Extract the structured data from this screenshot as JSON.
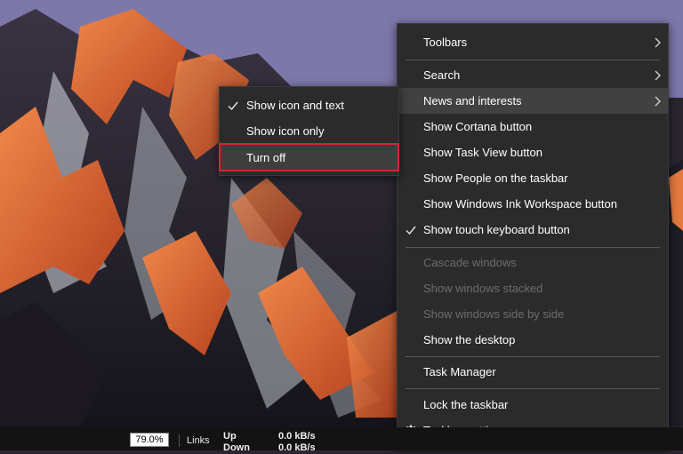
{
  "context_menu": {
    "items": [
      {
        "label": "Toolbars",
        "submenu": true,
        "checked": false,
        "disabled": false
      },
      {
        "label": "Search",
        "submenu": true,
        "checked": false,
        "disabled": false
      },
      {
        "label": "News and interests",
        "submenu": true,
        "checked": false,
        "disabled": false,
        "hovered": true
      },
      {
        "label": "Show Cortana button",
        "submenu": false,
        "checked": false,
        "disabled": false
      },
      {
        "label": "Show Task View button",
        "submenu": false,
        "checked": false,
        "disabled": false
      },
      {
        "label": "Show People on the taskbar",
        "submenu": false,
        "checked": false,
        "disabled": false
      },
      {
        "label": "Show Windows Ink Workspace button",
        "submenu": false,
        "checked": false,
        "disabled": false
      },
      {
        "label": "Show touch keyboard button",
        "submenu": false,
        "checked": true,
        "disabled": false
      },
      {
        "label": "Cascade windows",
        "submenu": false,
        "checked": false,
        "disabled": true
      },
      {
        "label": "Show windows stacked",
        "submenu": false,
        "checked": false,
        "disabled": true
      },
      {
        "label": "Show windows side by side",
        "submenu": false,
        "checked": false,
        "disabled": true
      },
      {
        "label": "Show the desktop",
        "submenu": false,
        "checked": false,
        "disabled": false
      },
      {
        "label": "Task Manager",
        "submenu": false,
        "checked": false,
        "disabled": false
      },
      {
        "label": "Lock the taskbar",
        "submenu": false,
        "checked": false,
        "disabled": false
      },
      {
        "label": "Taskbar settings",
        "submenu": false,
        "checked": false,
        "disabled": false,
        "icon": "gear-icon"
      }
    ]
  },
  "submenu": {
    "items": [
      {
        "label": "Show icon and text",
        "checked": true
      },
      {
        "label": "Show icon only",
        "checked": false
      },
      {
        "label": "Turn off",
        "checked": false,
        "highlighted": true
      }
    ]
  },
  "taskbar": {
    "progress_label": "79.0%",
    "progress_value": 0.79,
    "links_label": "Links",
    "net_up_label": "Up",
    "net_down_label": "Down",
    "net_up_value": "0.0 kB/s",
    "net_down_value": "0.0 kB/s"
  },
  "colors": {
    "menu_bg": "#2b2b2b",
    "menu_hover": "#414141",
    "highlight_outline": "#d9232e",
    "disabled_text": "#6d6d6d"
  }
}
